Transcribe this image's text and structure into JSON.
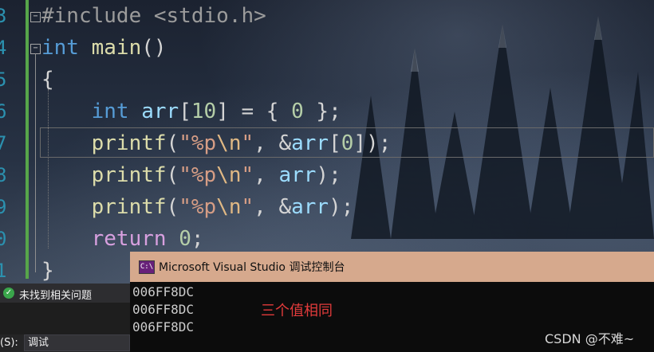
{
  "editor": {
    "gutter_numbers": [
      "3",
      "4",
      "5",
      "6",
      "7",
      "8",
      "9",
      "0",
      "1"
    ],
    "lines": [
      [
        {
          "t": "#include <stdio.h>",
          "c": "pp"
        }
      ],
      [
        {
          "t": "int",
          "c": "kw"
        },
        {
          "t": " ",
          "c": "pun"
        },
        {
          "t": "main",
          "c": "fn"
        },
        {
          "t": "()",
          "c": "pun"
        }
      ],
      [
        {
          "t": "{",
          "c": "pun"
        }
      ],
      [
        {
          "t": "    ",
          "c": "pun"
        },
        {
          "t": "int",
          "c": "kw"
        },
        {
          "t": " ",
          "c": "pun"
        },
        {
          "t": "arr",
          "c": "var"
        },
        {
          "t": "[",
          "c": "pun"
        },
        {
          "t": "10",
          "c": "num"
        },
        {
          "t": "] = { ",
          "c": "pun"
        },
        {
          "t": "0",
          "c": "num"
        },
        {
          "t": " };",
          "c": "pun"
        }
      ],
      [
        {
          "t": "    ",
          "c": "pun"
        },
        {
          "t": "printf",
          "c": "fn"
        },
        {
          "t": "(",
          "c": "pun"
        },
        {
          "t": "\"%p",
          "c": "str"
        },
        {
          "t": "\\n",
          "c": "esc"
        },
        {
          "t": "\"",
          "c": "str"
        },
        {
          "t": ", &",
          "c": "pun"
        },
        {
          "t": "arr",
          "c": "var"
        },
        {
          "t": "[",
          "c": "pun"
        },
        {
          "t": "0",
          "c": "num"
        },
        {
          "t": "]);",
          "c": "pun"
        }
      ],
      [
        {
          "t": "    ",
          "c": "pun"
        },
        {
          "t": "printf",
          "c": "fn"
        },
        {
          "t": "(",
          "c": "pun"
        },
        {
          "t": "\"%p",
          "c": "str"
        },
        {
          "t": "\\n",
          "c": "esc"
        },
        {
          "t": "\"",
          "c": "str"
        },
        {
          "t": ", ",
          "c": "pun"
        },
        {
          "t": "arr",
          "c": "var"
        },
        {
          "t": ");",
          "c": "pun"
        }
      ],
      [
        {
          "t": "    ",
          "c": "pun"
        },
        {
          "t": "printf",
          "c": "fn"
        },
        {
          "t": "(",
          "c": "pun"
        },
        {
          "t": "\"%p",
          "c": "str"
        },
        {
          "t": "\\n",
          "c": "esc"
        },
        {
          "t": "\"",
          "c": "str"
        },
        {
          "t": ", &",
          "c": "pun"
        },
        {
          "t": "arr",
          "c": "var"
        },
        {
          "t": ");",
          "c": "pun"
        }
      ],
      [
        {
          "t": "    ",
          "c": "pun"
        },
        {
          "t": "return",
          "c": "ctl"
        },
        {
          "t": " ",
          "c": "pun"
        },
        {
          "t": "0",
          "c": "num"
        },
        {
          "t": ";",
          "c": "pun"
        }
      ],
      [
        {
          "t": "}",
          "c": "pun"
        }
      ]
    ]
  },
  "console": {
    "icon_text": "C:\\",
    "title": "Microsoft Visual Studio 调试控制台",
    "output_lines": [
      "006FF8DC",
      "006FF8DC",
      "006FF8DC"
    ],
    "annotation": "三个值相同",
    "watermark": "CSDN @不难~"
  },
  "status": {
    "message": "未找到相关问题"
  },
  "output_panel": {
    "label": "(S):",
    "selected": "调试"
  },
  "colors": {
    "keyword": "#569cd6",
    "function": "#dcdcaa",
    "variable": "#9cdcfe",
    "number": "#b5cea8",
    "string": "#d69d85",
    "control": "#d8a0df",
    "preprocessor": "#9b9b9b",
    "change_bar": "#57a64a",
    "console_title_bg": "#d6a98d",
    "annotation": "#e23b3b"
  }
}
